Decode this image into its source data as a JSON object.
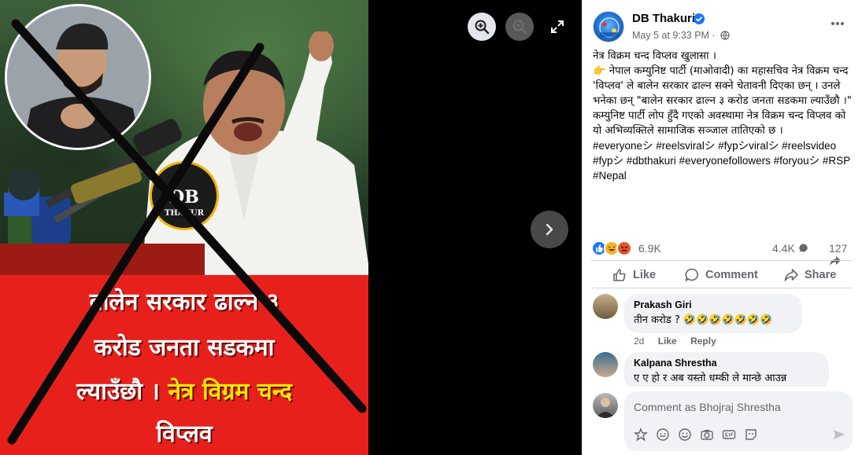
{
  "viewer": {
    "banner_line1": "बालेन सरकार ढाल्न ३",
    "banner_line2": "करोड जनता सडकमा",
    "banner_line3a": "ल्याउँछौ ।",
    "banner_line3b": "नेत्र विग्रम चन्द",
    "banner_line4": "विप्लव",
    "logo_text_top": "DB",
    "logo_text_bottom": "THAKUR",
    "icons": [
      "zoom-in-icon",
      "zoom-out-icon",
      "fullscreen-icon",
      "chevron-right-icon"
    ]
  },
  "post": {
    "author": "DB Thakuri",
    "timestamp": "May 5 at 9:33 PM ·",
    "paragraphs": [
      "नेत्र विक्रम चन्द विप्लव खुलासा ।",
      "👉 नेपाल कम्युनिष्ट पार्टी (माओवादी) का महासचिव नेत्र विक्रम चन्द 'विप्लव' ले बालेन सरकार ढाल्न सक्ने चेतावनी दिएका छन् । उनले भनेका छन् \"बालेन सरकार ढाल्न ३ करोड जनता सडकमा ल्याउँछौ ।\"",
      "कम्युनिष्ट पार्टी लोप हुँदै गएको अवस्थामा नेत्र विक्रम चन्द विप्लव को यो अभिव्यक्तिले सामाजिक सञ्जाल तातिएको छ ।"
    ],
    "hashtags": "#everyoneシ #reelsviralシ #fypシviralシ #reelsvideo #fypシ #dbthakuri #everyonefollowers #foryouシ #RSP #Nepal",
    "reaction_count": "6.9K",
    "comment_count": "4.4K",
    "share_count": "127",
    "accent_color": "#1877f2"
  },
  "actions": {
    "like": "Like",
    "comment": "Comment",
    "share": "Share"
  },
  "comments": [
    {
      "name": "Prakash Giri",
      "text": "तीन करोड ? 🤣🤣🤣🤣🤣🤣🤣",
      "time": "2d",
      "like": "Like",
      "reply": "Reply"
    },
    {
      "name": "Kalpana Shrestha",
      "text": "ए ए हो र अब यस्तो धम्की ले मान्छे आउन्न"
    }
  ],
  "composer": {
    "placeholder": "Comment as Bhojraj Shrestha",
    "tools": [
      "sticker-icon",
      "avatar-sticker-icon",
      "emoji-icon",
      "camera-icon",
      "gif-icon",
      "sticker-face-icon",
      "send-icon"
    ]
  }
}
